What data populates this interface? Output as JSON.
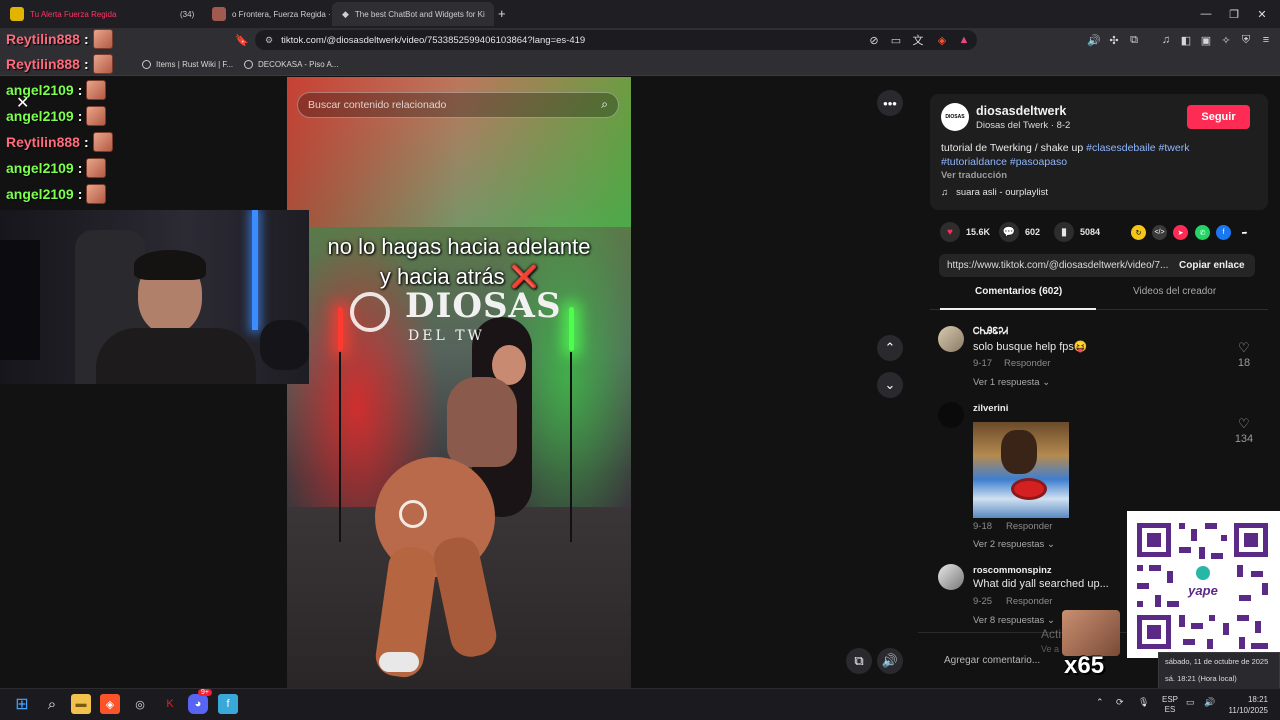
{
  "browser": {
    "tabs": [
      {
        "label": "Tu Alerta Fuerza Regida",
        "active": false
      },
      {
        "label": "(34)",
        "active": false
      },
      {
        "label": "o Frontera, Fuerza Regida ·",
        "active": false
      },
      {
        "label": "The best ChatBot and Widgets for Ki",
        "active": true
      }
    ],
    "new_tab": "+",
    "url": "tiktok.com/@diosasdeltwerk/video/7533852599406103864?lang=es-419",
    "bookmarks": [
      {
        "label": "Items | Rust Wiki | F..."
      },
      {
        "label": "DECOKASA - Piso A..."
      }
    ]
  },
  "video": {
    "search_placeholder": "Buscar contenido relacionado",
    "caption_line1": "no lo hagas hacia adelante",
    "caption_line2": "y hacia atrás ❌",
    "logo_word": "DIOSAS",
    "logo_sub": "DEL TW"
  },
  "author": {
    "username": "diosasdeltwerk",
    "display": "Diosas del Twerk · 8-2",
    "avatar_text": "DIOSAS",
    "follow_label": "Seguir",
    "description": "tutorial de Twerking / shake up",
    "hashtags_line1": "#clasesdebaile #twerk",
    "hashtags_line2": "#tutorialdance #pasoapaso",
    "translate": "Ver traducción",
    "music": "suara asli - ourplaylist"
  },
  "stats": {
    "likes": "15.6K",
    "comments": "602",
    "saves": "5084"
  },
  "link": {
    "url": "https://www.tiktok.com/@diosasdeltwerk/video/7...",
    "copy_label": "Copiar enlace"
  },
  "panel_tabs": {
    "comments": "Comentarios (602)",
    "creator_videos": "Videos del creador"
  },
  "comments": [
    {
      "user": "ᏟᏂᎯᏋᎮᏗ",
      "text": "solo busque help fps😝",
      "date": "9-17",
      "reply": "Responder",
      "more": "Ver 1 respuesta",
      "likes": "18"
    },
    {
      "user": "zilverini",
      "text": "",
      "date": "9-18",
      "reply": "Responder",
      "more": "Ver 2 respuestas",
      "likes": "134"
    },
    {
      "user": "roscommonspinz",
      "text": "What did yall searched up...",
      "date": "9-25",
      "reply": "Responder",
      "more": "Ver 8 respuestas",
      "likes": ""
    }
  ],
  "comment_input_placeholder": "Agregar comentario...",
  "chat": [
    {
      "user": "Reytilin888",
      "sep": ":",
      "color": "#ff6b7e"
    },
    {
      "user": "Reytilin888",
      "sep": ":",
      "color": "#ff6b7e"
    },
    {
      "user": "angel2109",
      "sep": ":",
      "color": "#7dff4f"
    },
    {
      "user": "angel2109",
      "sep": ":",
      "color": "#7dff4f"
    },
    {
      "user": "Reytilin888",
      "sep": ":",
      "color": "#ff6b7e"
    },
    {
      "user": "angel2109",
      "sep": ":",
      "color": "#7dff4f"
    },
    {
      "user": "angel2109",
      "sep": ":",
      "color": "#7dff4f"
    }
  ],
  "overlay": {
    "multiplier": "x65",
    "activate_text": "Acti",
    "activate_sub": "Ve a"
  },
  "tooltip": {
    "date_long": "sábado, 11 de octubre de 2025",
    "date_short": "sá. 18:21 (Hora local)"
  },
  "taskbar": {
    "lang": "ESP",
    "lang_sub": "ES",
    "time": "18:21",
    "date": "11/10/2025",
    "badge": "9+"
  }
}
